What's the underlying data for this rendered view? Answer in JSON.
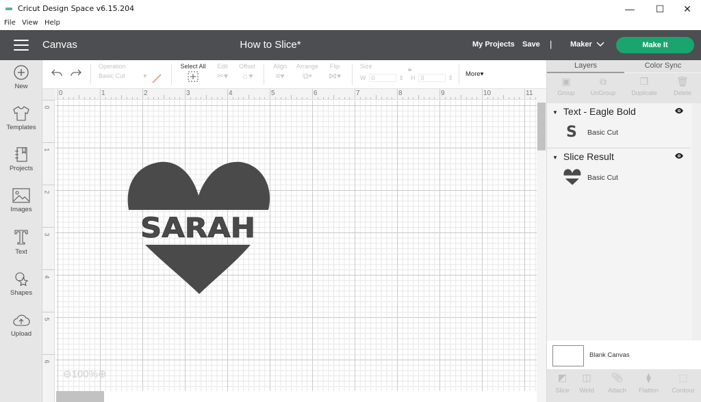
{
  "window": {
    "title": "Cricut Design Space  v6.15.204",
    "controls": {
      "minimize": "—",
      "maximize": "☐",
      "close": "✕"
    }
  },
  "menubar": [
    "File",
    "View",
    "Help"
  ],
  "header": {
    "section": "Canvas",
    "project_title": "How to Slice*",
    "my_projects": "My Projects",
    "save": "Save",
    "separator": "|",
    "machine": "Maker",
    "make_it": "Make It",
    "accent_color": "#1aa56f"
  },
  "sidebar": {
    "items": [
      {
        "label": "New",
        "icon": "plus-circle-icon"
      },
      {
        "label": "Templates",
        "icon": "tshirt-icon"
      },
      {
        "label": "Projects",
        "icon": "notebook-icon"
      },
      {
        "label": "Images",
        "icon": "image-icon"
      },
      {
        "label": "Text",
        "icon": "text-icon"
      },
      {
        "label": "Shapes",
        "icon": "shapes-icon"
      },
      {
        "label": "Upload",
        "icon": "cloud-upload-icon"
      }
    ]
  },
  "toolbar": {
    "operation_label": "Operation",
    "operation_value": "Basic Cut",
    "select_all": "Select All",
    "edit": "Edit",
    "offset": "Offset",
    "align": "Align",
    "arrange": "Arrange",
    "flip": "Flip",
    "size": "Size",
    "w_label": "W",
    "w_value": "0",
    "h_label": "H",
    "h_value": "0",
    "more": "More▾"
  },
  "canvas": {
    "ruler_top": [
      "0",
      "1",
      "2",
      "3",
      "4",
      "5",
      "6",
      "7",
      "8",
      "9",
      "10",
      "11"
    ],
    "ruler_left": [
      "0",
      "1",
      "2",
      "3",
      "4",
      "5",
      "6"
    ],
    "zoom_level": "100%",
    "design_text": "SARAH",
    "design_color": "#4a4a4a"
  },
  "panel": {
    "tabs": [
      "Layers",
      "Color Sync"
    ],
    "layer_actions": [
      "Group",
      "UnGroup",
      "Duplicate",
      "Delete"
    ],
    "layers": [
      {
        "name": "Text - Eagle Bold",
        "sub": "Basic Cut",
        "thumb": "S"
      },
      {
        "name": "Slice Result",
        "sub": "Basic Cut",
        "thumb": "heart"
      }
    ],
    "blank_canvas": "Blank Canvas",
    "bottom_actions": [
      "Slice",
      "Weld",
      "Attach",
      "Flatten",
      "Contour"
    ]
  }
}
